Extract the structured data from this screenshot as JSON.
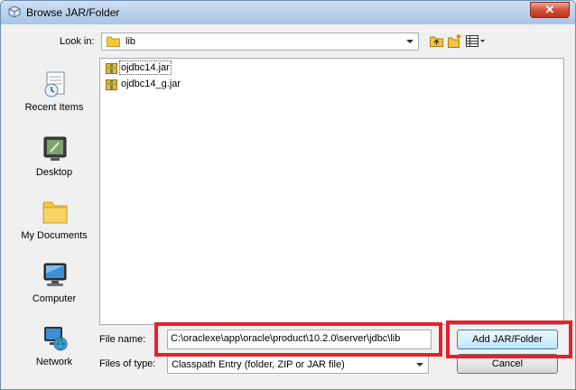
{
  "window": {
    "title": "Browse JAR/Folder",
    "close_label": "✕"
  },
  "lookin": {
    "label": "Look in:",
    "value": "lib"
  },
  "toolbar": {
    "icons": [
      "up-one-level-icon",
      "create-new-folder-icon",
      "view-menu-icon"
    ]
  },
  "places": [
    {
      "label": "Recent Items",
      "icon": "recent-items-icon"
    },
    {
      "label": "Desktop",
      "icon": "desktop-icon"
    },
    {
      "label": "My Documents",
      "icon": "my-documents-icon"
    },
    {
      "label": "Computer",
      "icon": "computer-icon"
    },
    {
      "label": "Network",
      "icon": "network-icon"
    }
  ],
  "files": [
    {
      "name": "ojdbc14.jar",
      "selected": true
    },
    {
      "name": "ojdbc14_g.jar",
      "selected": false
    }
  ],
  "filename": {
    "label": "File name:",
    "value": "C:\\oraclexe\\app\\oracle\\product\\10.2.0\\server\\jdbc\\lib"
  },
  "filetype": {
    "label": "Files of type:",
    "value": "Classpath Entry (folder, ZIP or JAR file)"
  },
  "buttons": {
    "add": "Add JAR/Folder",
    "cancel": "Cancel"
  },
  "colors": {
    "highlight": "#e8202a",
    "title_bar": "#b9d1ea",
    "folder": "#f5c542"
  }
}
